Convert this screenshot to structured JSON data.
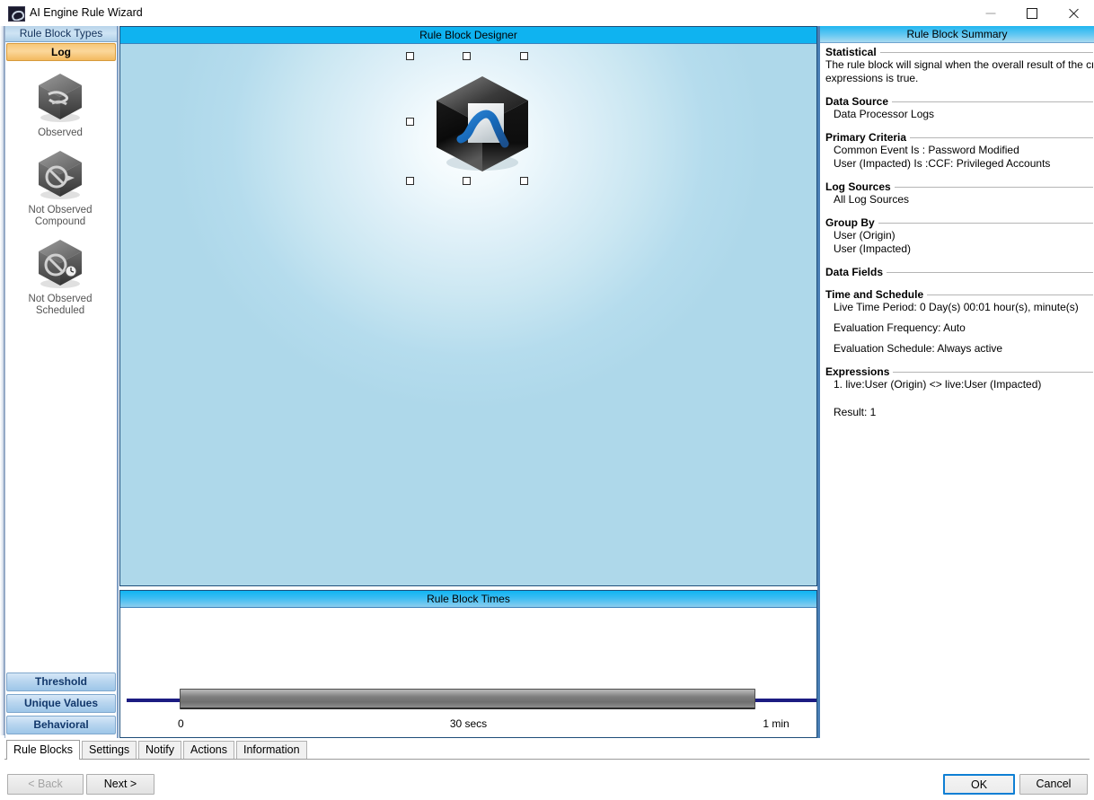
{
  "window": {
    "title": "AI Engine Rule Wizard",
    "icon": "app-icon",
    "minimize_label": "—",
    "maximize_label": "☐",
    "close_label": "✕"
  },
  "types_panel": {
    "caption": "Rule Block Types",
    "group_label": "Log",
    "blocks": [
      {
        "label_line1": "Observed",
        "label_line2": "",
        "icon": "observed-cube-icon"
      },
      {
        "label_line1": "Not Observed",
        "label_line2": "Compound",
        "icon": "not-observed-compound-cube-icon"
      },
      {
        "label_line1": "Not Observed",
        "label_line2": "Scheduled",
        "icon": "not-observed-scheduled-cube-icon"
      }
    ],
    "categories": [
      {
        "label": "Threshold"
      },
      {
        "label": "Unique Values"
      },
      {
        "label": "Behavioral"
      }
    ]
  },
  "designer": {
    "caption": "Rule Block Designer",
    "selected_block_icon": "statistical-cube-icon",
    "handle_count": 8
  },
  "times": {
    "caption": "Rule Block Times",
    "ticks": [
      {
        "label": "0"
      },
      {
        "label": "30 secs"
      },
      {
        "label": "1 min"
      }
    ]
  },
  "summary": {
    "caption": "Rule Block Summary",
    "sections": [
      {
        "heading": "Statistical",
        "paragraph": [
          "The rule block will signal when the overall result of the criteria",
          "expressions is true."
        ],
        "lines": []
      },
      {
        "heading": "Data Source",
        "paragraph": [],
        "lines": [
          "Data Processor Logs"
        ]
      },
      {
        "heading": "Primary Criteria",
        "paragraph": [],
        "lines": [
          "Common Event Is : Password Modified",
          "User (Impacted) Is :CCF: Privileged Accounts"
        ]
      },
      {
        "heading": "Log Sources",
        "paragraph": [],
        "lines": [
          "All Log Sources"
        ]
      },
      {
        "heading": "Group By",
        "paragraph": [],
        "lines": [
          "User (Origin)",
          "User (Impacted)"
        ]
      },
      {
        "heading": "Data Fields",
        "paragraph": [],
        "lines": []
      },
      {
        "heading": "Time and Schedule",
        "paragraph": [],
        "lines": [
          "Live Time Period: 0 Day(s) 00:01 hour(s), minute(s)",
          "",
          "Evaluation Frequency: Auto",
          "",
          "Evaluation Schedule: Always active"
        ]
      },
      {
        "heading": "Expressions",
        "paragraph": [],
        "lines": [
          "1. live:User (Origin) <> live:User (Impacted)",
          "",
          "",
          "Result:  1"
        ]
      }
    ]
  },
  "tabs": [
    {
      "label": "Rule Blocks",
      "active": true
    },
    {
      "label": "Settings",
      "active": false
    },
    {
      "label": "Notify",
      "active": false
    },
    {
      "label": "Actions",
      "active": false
    },
    {
      "label": "Information",
      "active": false
    }
  ],
  "buttons": {
    "back": "< Back",
    "next": "Next >",
    "ok": "OK",
    "cancel": "Cancel"
  },
  "colors": {
    "designer_caption": "#0fb3f0",
    "group_highlight": "#f7c87a",
    "accent_blue": "#1f4e79",
    "timeline_rail": "#1c1c82",
    "default_button_border": "#0f7fd4"
  }
}
